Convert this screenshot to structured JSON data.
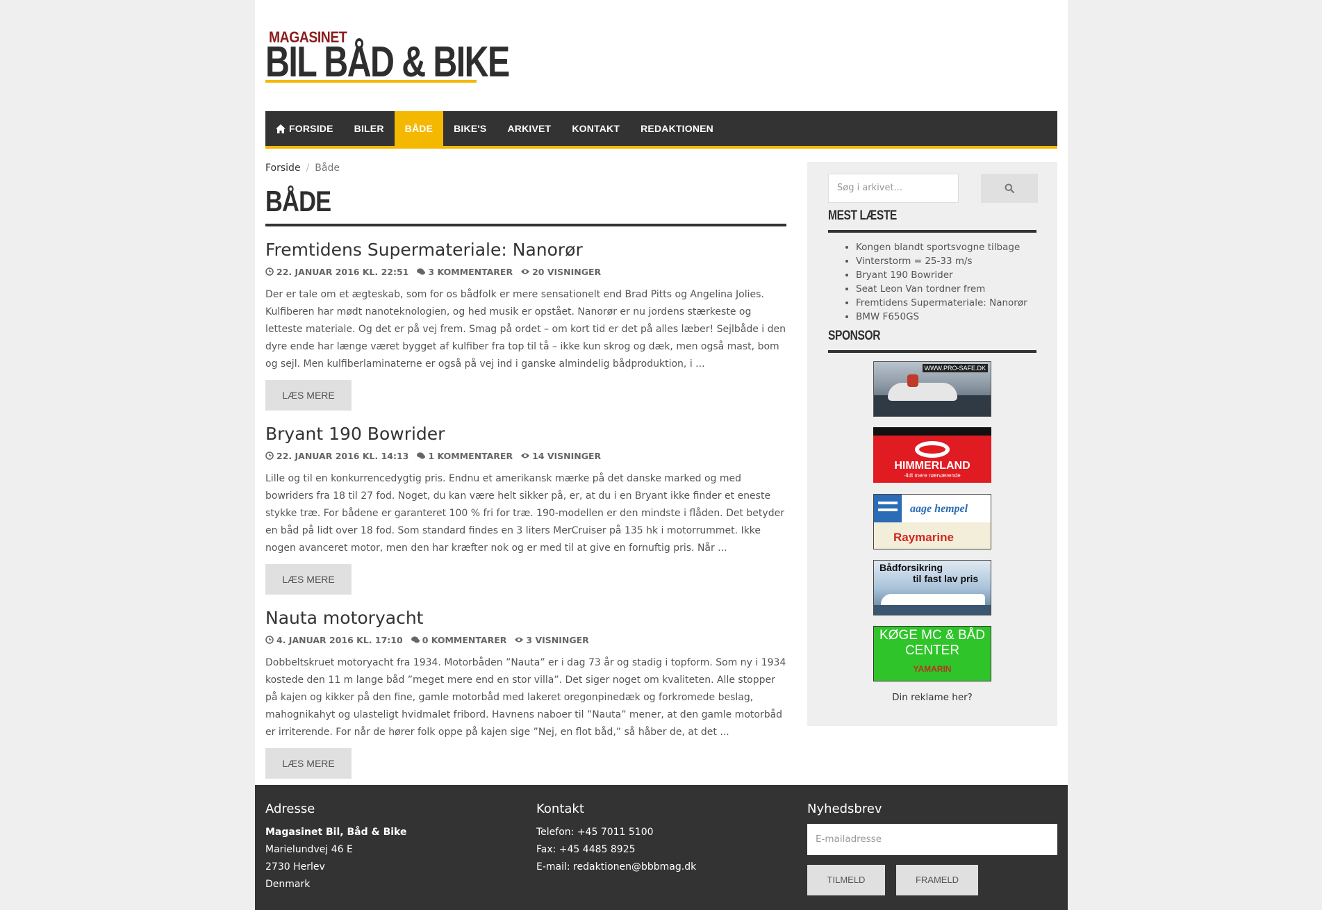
{
  "brand": {
    "logo_top": "MAGASINET",
    "logo_main": "BIL BÅD & BIKE",
    "accent_color": "#f5b800",
    "nav_color": "#333333"
  },
  "nav": {
    "items": [
      {
        "label": "FORSIDE",
        "icon": "home-icon",
        "active": false
      },
      {
        "label": "BILER",
        "active": false
      },
      {
        "label": "BÅDE",
        "active": true
      },
      {
        "label": "BIKE'S",
        "active": false
      },
      {
        "label": "ARKIVET",
        "active": false
      },
      {
        "label": "KONTAKT",
        "active": false
      },
      {
        "label": "REDAKTIONEN",
        "active": false
      }
    ]
  },
  "breadcrumb": {
    "home": "Forside",
    "separator": "/",
    "current": "Både"
  },
  "page_title": "BÅDE",
  "posts": [
    {
      "title": "Fremtidens Supermateriale: Nanorør",
      "date": "22. JANUAR 2016 KL. 22:51",
      "comments": "3 KOMMENTARER",
      "views": "20 VISNINGER",
      "excerpt": "Der er tale om et ægteskab, som for os bådfolk er mere sensationelt end Brad Pitts og Angelina Jolies. Kulfiberen har mødt nanoteknologien, og hed musik er opstået. Nanorør er nu jordens stærkeste og letteste materiale. Og det er på vej frem. Smag på ordet – om kort tid er det på alles læber! Sejlbåde i den dyre ende har længe været bygget af kulfiber fra top til tå – ikke kun skrog og dæk, men også mast, bom og sejl. Men kulfiberlaminaterne er også på vej ind i ganske almindelig bådproduktion, i ...",
      "read_more": "LÆS MERE"
    },
    {
      "title": "Bryant 190 Bowrider",
      "date": "22. JANUAR 2016 KL. 14:13",
      "comments": "1 KOMMENTARER",
      "views": "14 VISNINGER",
      "excerpt": "Lille og til en konkurrencedygtig pris. Endnu et amerikansk mærke på det danske marked og med bowriders fra 18 til 27 fod. Noget, du kan være helt sikker på, er, at du i en Bryant ikke finder et eneste stykke træ. For bådene er garanteret 100 % fri for træ. 190-modellen er den mindste i flåden. Det betyder en båd på lidt over 18 fod. Som standard findes en 3 liters MerCruiser på 135 hk i motorrummet. Ikke nogen avanceret motor, men den har kræfter nok og er med til at give en fornuftig pris. Når ...",
      "read_more": "LÆS MERE"
    },
    {
      "title": "Nauta motoryacht",
      "date": "4. JANUAR 2016 KL. 17:10",
      "comments": "0 KOMMENTARER",
      "views": "3 VISNINGER",
      "excerpt": "Dobbeltskruet motoryacht fra 1934. Motorbåden ”Nauta” er i dag 73 år og stadig i topform. Som ny i 1934 kostede den 11 m lange båd ”meget mere end en stor villa”. Det siger noget om kvaliteten. Alle stopper på kajen og kikker på den fine, gamle motorbåd med lakeret oregonpinedæk og forkromede beslag, mahognikahyt og ulasteligt hvidmalet fribord. Havnens naboer til ”Nauta” mener, at den gamle motorbåd er irriterende. For når de hører folk oppe på kajen sige ”Nej, en flot båd,” så håber de, at det ...",
      "read_more": "LÆS MERE"
    }
  ],
  "sidebar": {
    "search_placeholder": "Søg i arkivet...",
    "most_read_heading": "MEST LÆSTE",
    "most_read": [
      "Kongen blandt sportsvogne tilbage",
      "Vinterstorm = 25-33 m/s",
      "Bryant 190 Bowrider",
      "Seat Leon Van tordner frem",
      "Fremtidens Supermateriale: Nanorør",
      "BMW F650GS"
    ],
    "sponsor_heading": "SPONSOR",
    "ads": [
      {
        "text": "WWW.PRO-SAFE.DK"
      },
      {
        "text": "HIMMERLAND",
        "sub": "-lidt mere nærværende"
      },
      {
        "text": "aage hempel",
        "sub": "Raymarine"
      },
      {
        "text": "Bådforsikring",
        "sub": "til fast lav pris"
      },
      {
        "text": "KØGE MC & BÅD",
        "sub": "CENTER",
        "sub2": "YAMARIN"
      }
    ],
    "ad_cta": "Din reklame her?"
  },
  "footer": {
    "address": {
      "heading": "Adresse",
      "name": "Magasinet Bil, Båd & Bike",
      "street": "Marielundvej 46 E",
      "city": "2730 Herlev",
      "country": "Denmark"
    },
    "contact": {
      "heading": "Kontakt",
      "phone": "Telefon: +45 7011 5100",
      "fax": "Fax: +45 4485 8925",
      "email": "E-mail: redaktionen@bbbmag.dk"
    },
    "newsletter": {
      "heading": "Nyhedsbrev",
      "placeholder": "E-mailadresse",
      "subscribe": "TILMELD",
      "unsubscribe": "FRAMELD"
    }
  }
}
